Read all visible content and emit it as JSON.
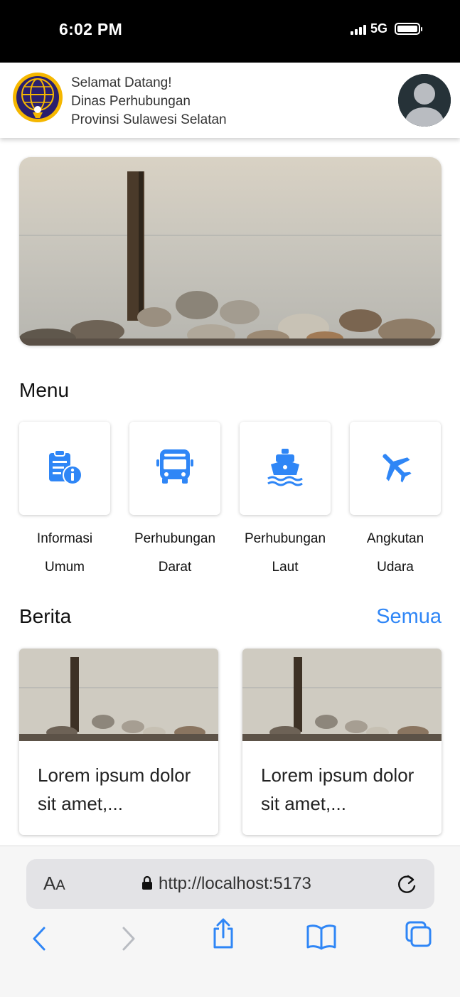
{
  "status_bar": {
    "time": "6:02 PM",
    "network": "5G",
    "battery_level": 1.0
  },
  "header": {
    "greeting": "Selamat Datang!",
    "org_line1": "Dinas Perhubungan",
    "org_line2": "Provinsi Sulawesi Selatan",
    "logo_icon": "dinas-perhubungan-emblem",
    "avatar_icon": "user-avatar-icon"
  },
  "menu": {
    "title": "Menu",
    "items": [
      {
        "line1": "Informasi",
        "line2": "Umum",
        "icon": "info-clipboard-icon"
      },
      {
        "line1": "Perhubungan",
        "line2": "Darat",
        "icon": "bus-icon"
      },
      {
        "line1": "Perhubungan",
        "line2": "Laut",
        "icon": "ship-icon"
      },
      {
        "line1": "Angkutan",
        "line2": "Udara",
        "icon": "airplane-icon"
      }
    ]
  },
  "news": {
    "title": "Berita",
    "see_all": "Semua",
    "items": [
      {
        "text": "Lorem ipsum dolor sit amet,..."
      },
      {
        "text": "Lorem ipsum dolor sit amet,..."
      }
    ]
  },
  "browser": {
    "text_size_label_big": "A",
    "text_size_label_small": "A",
    "url": "http://localhost:5173"
  },
  "colors": {
    "accent": "#2f86f6",
    "logo_navy": "#2a1f6e",
    "logo_gold": "#f5b700"
  }
}
